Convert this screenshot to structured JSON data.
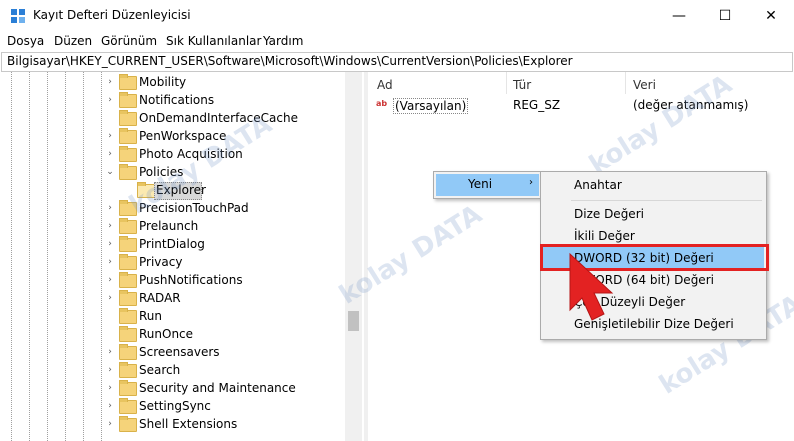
{
  "window": {
    "title": "Kayıt Defteri Düzenleyicisi",
    "controls": {
      "minimize": "—",
      "maximize": "☐",
      "close": "✕"
    }
  },
  "menu": [
    "Dosya",
    "Düzen",
    "Görünüm",
    "Sık Kullanılanlar",
    "Yardım"
  ],
  "address": "Bilgisayar\\HKEY_CURRENT_USER\\Software\\Microsoft\\Windows\\CurrentVersion\\Policies\\Explorer",
  "tree": {
    "items": [
      {
        "label": "Mobility",
        "expander": "›"
      },
      {
        "label": "Notifications",
        "expander": "›"
      },
      {
        "label": "OnDemandInterfaceCache",
        "expander": ""
      },
      {
        "label": "PenWorkspace",
        "expander": "›"
      },
      {
        "label": "Photo Acquisition",
        "expander": "›"
      },
      {
        "label": "Policies",
        "expander": "⌄"
      },
      {
        "label": "Explorer",
        "expander": "",
        "selected": true
      },
      {
        "label": "PrecisionTouchPad",
        "expander": "›"
      },
      {
        "label": "Prelaunch",
        "expander": "›"
      },
      {
        "label": "PrintDialog",
        "expander": "›"
      },
      {
        "label": "Privacy",
        "expander": "›"
      },
      {
        "label": "PushNotifications",
        "expander": "›"
      },
      {
        "label": "RADAR",
        "expander": "›"
      },
      {
        "label": "Run",
        "expander": ""
      },
      {
        "label": "RunOnce",
        "expander": ""
      },
      {
        "label": "Screensavers",
        "expander": "›"
      },
      {
        "label": "Search",
        "expander": "›"
      },
      {
        "label": "Security and Maintenance",
        "expander": "›"
      },
      {
        "label": "SettingSync",
        "expander": "›"
      },
      {
        "label": "Shell Extensions",
        "expander": "›"
      }
    ]
  },
  "values": {
    "columns": [
      "Ad",
      "Tür",
      "Veri"
    ],
    "rows": [
      {
        "name": "(Varsayılan)",
        "type": "REG_SZ",
        "data": "(değer atanmamış)",
        "icon": "ab"
      }
    ]
  },
  "context_menu": {
    "parent_label": "Yeni",
    "parent_arrow": "›",
    "items": [
      "Anahtar",
      "Dize Değeri",
      "İkili Değer",
      "DWORD (32 bit) Değeri",
      "QWORD (64 bit) Değeri",
      "Çok Düzeyli Değer",
      "Genişletilebilir Dize Değeri"
    ],
    "highlighted": "DWORD (32 bit) Değeri"
  },
  "watermark": "kolay DATA",
  "colors": {
    "highlight": "#91c9f7",
    "annotation_red": "#e32222",
    "folder": "#f5d37a"
  }
}
